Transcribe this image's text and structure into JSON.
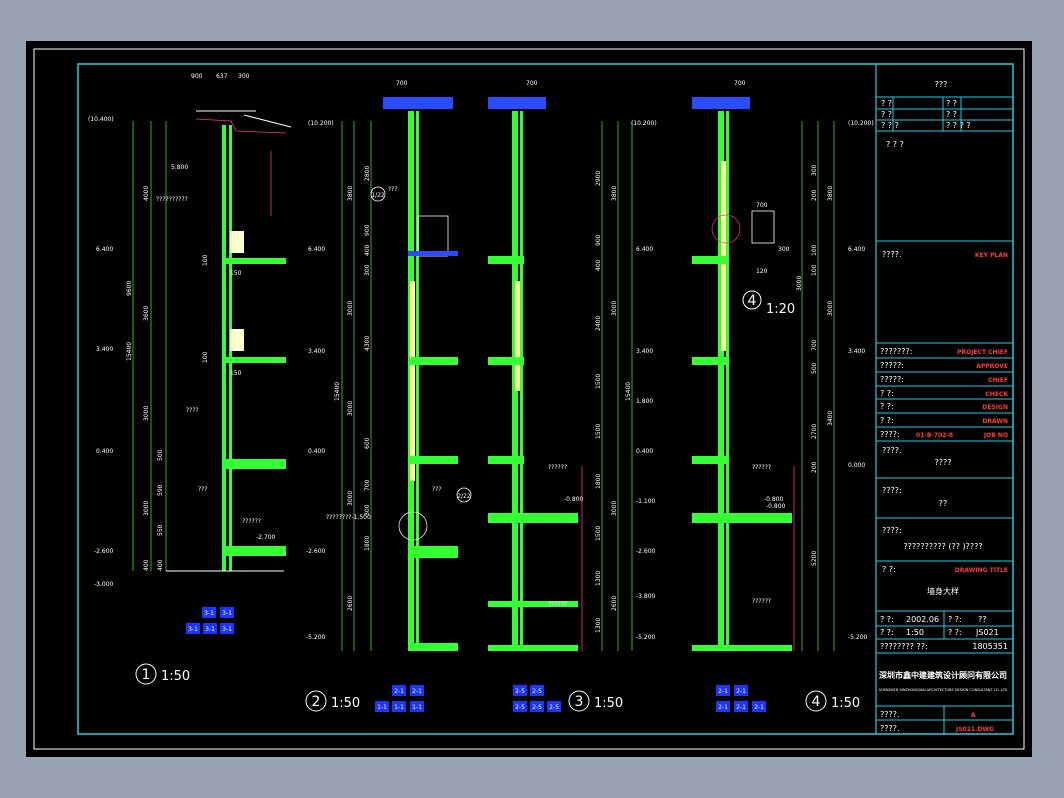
{
  "sheet": {
    "title_block": {
      "header": "???",
      "grid_rows": [
        [
          "? ?",
          "? ?"
        ],
        [
          "? ?",
          "? ?"
        ],
        [
          "? ? ?",
          "? ? ? ?"
        ]
      ],
      "notes_label": "? ? ?",
      "key_plan_label": "????.",
      "key_plan_en": "KEY PLAN",
      "sign_rows": [
        {
          "cn": "???????:",
          "en": "PROJECT CHIEF"
        },
        {
          "cn": "?????:",
          "en": "APPROVE"
        },
        {
          "cn": "?????:",
          "en": "CHIEF"
        },
        {
          "cn": "? ?:",
          "en": "CHECK"
        },
        {
          "cn": "? ?:",
          "en": "DESIGN"
        },
        {
          "cn": "? ?:",
          "en": "DRAWN"
        }
      ],
      "job_no_label": "????:",
      "job_no_value": "01-B-702-8",
      "job_no_en": "JOB NO",
      "client_label": "????.",
      "client_value": "????",
      "project_label": "????:",
      "project_value": "??",
      "sub_label": "????:",
      "sub_value": "??????????  (?? )????",
      "drawing_title_label": "? ?:",
      "drawing_title_en": "DRAWING TITLE",
      "drawing_title_value": "墙身大样",
      "date_label": "? ?:",
      "date_value": "2002.06",
      "scale_label": "? ?:",
      "scale_value": "1:50",
      "sheet_label": "? ?:",
      "sheet_value": "??",
      "sheet_no_label": "? ?:",
      "sheet_no_value": "JS021",
      "cert_label": "????????  ??:",
      "cert_value": "1805351",
      "company_cn": "深圳市鑫中建建筑设计顾问有限公司",
      "company_en": "SHENZHEN XINZHONGJIAN ARCHITECTURE DESIGN CONSULTANT CO.,LTD",
      "rev_label": "????.",
      "rev_value": "A",
      "file_label": "????.",
      "file_value": "JS021.DWG"
    },
    "details": [
      {
        "number": "1",
        "scale": "1:50",
        "top_dims": [
          "900",
          "637",
          "300"
        ],
        "levels": [
          "(10.400)",
          "5.800",
          "6.400",
          "3.400",
          "0.400",
          "-2.600",
          "-3.000"
        ],
        "vert_dims": [
          "4000",
          "9600",
          "3600",
          "15400",
          "3000",
          "3000",
          "400"
        ],
        "inner_dims": [
          "500",
          "590",
          "550",
          "400",
          "100",
          "150",
          "100",
          "150"
        ],
        "notes": [
          "??????????",
          "????",
          "???",
          "??????",
          "-2.700"
        ],
        "tags": [
          [
            "3-1",
            "3-1"
          ],
          [
            "3-1",
            "3-1",
            "3-1"
          ]
        ]
      },
      {
        "number": "2",
        "scale": "1:50",
        "top_dims": [
          "700"
        ],
        "levels": [
          "(10.200)",
          "6.400",
          "3.400",
          "0.400",
          "-2.600",
          "-5.200"
        ],
        "vert_dims": [
          "3800",
          "3000",
          "15400",
          "3000",
          "3000",
          "2600"
        ],
        "inner_dims": [
          "2800",
          "900",
          "400",
          "300",
          "4300",
          "600",
          "700",
          "300",
          "1800"
        ],
        "notes": [
          "???",
          "???",
          "????????-1.500"
        ],
        "callouts": [
          "1/22",
          "2/22"
        ],
        "tags": [
          [
            "2-1",
            "2-1"
          ],
          [
            "1-1",
            "1-1",
            "1-1"
          ]
        ]
      },
      {
        "number": "3",
        "scale": "1:50",
        "top_dims": [
          "700"
        ],
        "levels": [
          "(10.200)",
          "6.400",
          "3.400",
          "1.800",
          "0.400",
          "-1.100",
          "-2.600",
          "-3.800",
          "-5.200"
        ],
        "vert_dims": [
          "3800",
          "3000",
          "15400",
          "3000",
          "2600"
        ],
        "inner_dims": [
          "2900",
          "900",
          "400",
          "2400",
          "1500",
          "1500",
          "1800",
          "1500",
          "1300",
          "1300"
        ],
        "notes": [
          "-0.800",
          "??????",
          "??????"
        ],
        "tags": [
          [
            "2-5",
            "2-5"
          ],
          [
            "2-5",
            "2-5",
            "2-5"
          ]
        ]
      },
      {
        "number": "4",
        "scale": "1:50",
        "top_dims": [
          "700"
        ],
        "levels": [
          "(10.200)",
          "6.400",
          "3.400",
          "0.000",
          "-0.800",
          "-5.200"
        ],
        "vert_dims": [
          "3800",
          "3000",
          "3400",
          "5200"
        ],
        "inner_dims": [
          "300",
          "200",
          "100",
          "100",
          "700",
          "500",
          "2700",
          "200",
          "3000"
        ],
        "notes": [
          "??????",
          "??????",
          "-0.800"
        ],
        "enlarged": {
          "number": "4",
          "scale": "1:20",
          "dims": [
            "700",
            "120",
            "300"
          ]
        },
        "tags": [
          [
            "2-1",
            "2-1"
          ],
          [
            "2-1",
            "2-1",
            "2-1"
          ]
        ]
      }
    ]
  }
}
